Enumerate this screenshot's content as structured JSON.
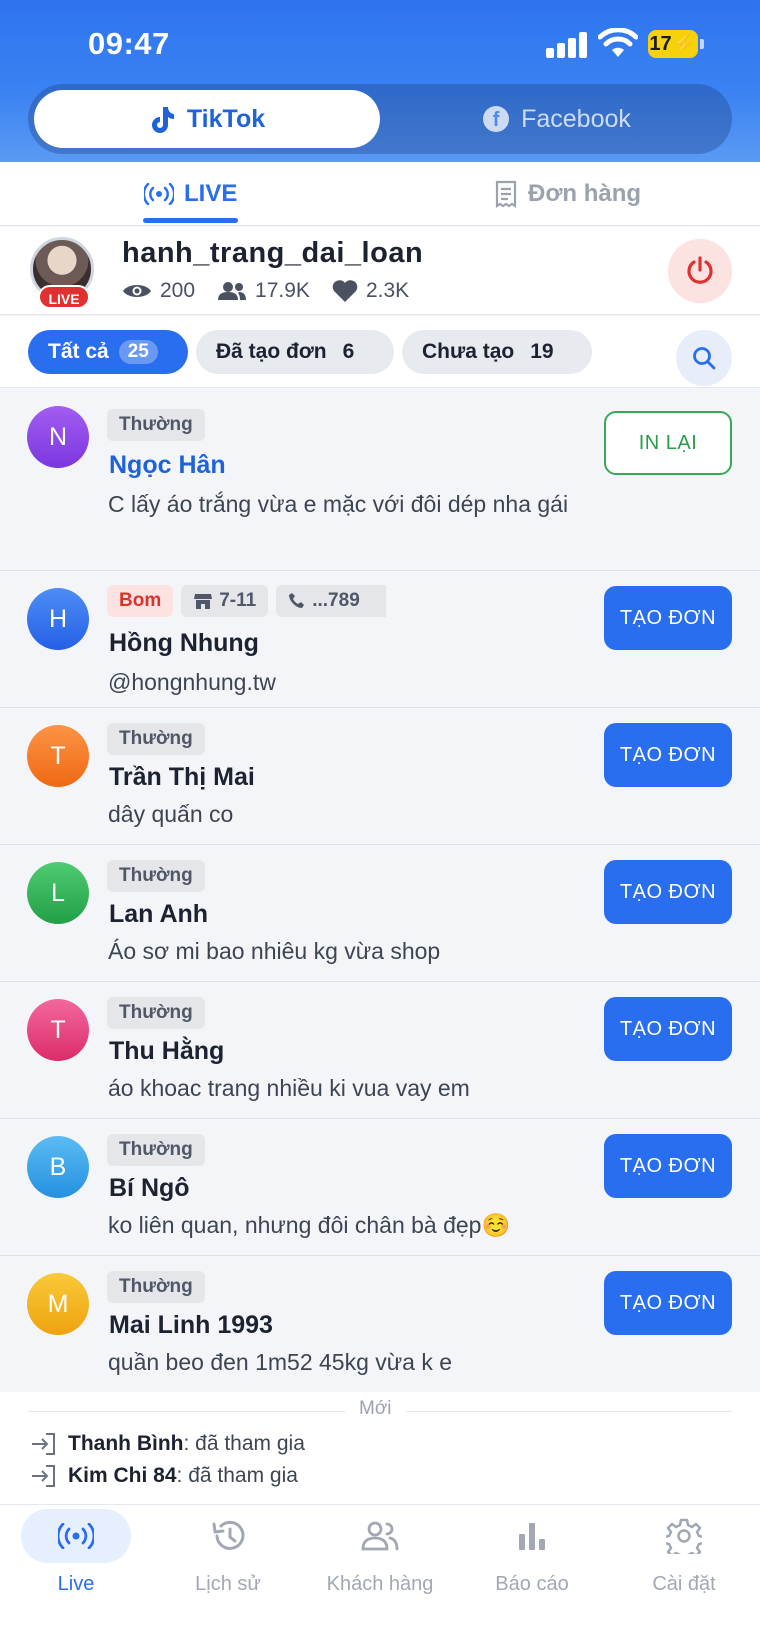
{
  "status": {
    "time": "09:47",
    "battery": "17"
  },
  "platforms": {
    "tiktok": "TikTok",
    "facebook": "Facebook"
  },
  "subtabs": {
    "live": "LIVE",
    "orders": "Đơn hàng"
  },
  "profile": {
    "username": "hanh_trang_dai_loan",
    "live_badge": "LIVE",
    "viewers": "200",
    "followers": "17.9K",
    "likes": "2.3K"
  },
  "filters": [
    {
      "label": "Tất cả",
      "count": "25"
    },
    {
      "label": "Đã tạo đơn",
      "count": "6"
    },
    {
      "label": "Chưa tạo",
      "count": "19"
    }
  ],
  "comments": [
    {
      "initial": "N",
      "color": "#8b45e8",
      "tag": "Thường",
      "name": "Ngọc Hân",
      "message": "C lấy áo trắng vừa e mặc với đôi dép nha gái",
      "action": "IN LẠI"
    },
    {
      "initial": "H",
      "color": "#2d6ff0",
      "tag": "Bom",
      "store": "7-11",
      "phone": "...789",
      "name": "Hồng Nhung",
      "message": "@hongnhung.tw",
      "action": "TẠO ĐƠN"
    },
    {
      "initial": "T",
      "color": "#f77a1c",
      "tag": "Thường",
      "name": "Trần Thị Mai",
      "message": "dây quấn co",
      "action": "TẠO ĐƠN"
    },
    {
      "initial": "L",
      "color": "#2fb455",
      "tag": "Thường",
      "name": "Lan Anh",
      "message": "Áo sơ mi bao nhiêu kg vừa shop",
      "action": "TẠO ĐƠN"
    },
    {
      "initial": "T",
      "color": "#e9447e",
      "tag": "Thường",
      "name": "Thu Hằng",
      "message": "áo khoac trang nhiều ki vua vay em",
      "action": "TẠO ĐƠN"
    },
    {
      "initial": "B",
      "color": "#3aa3ea",
      "tag": "Thường",
      "name": "Bí Ngô",
      "message": "ko liên quan, nhưng đôi chân bà đẹp☺️",
      "action": "TẠO ĐƠN"
    },
    {
      "initial": "M",
      "color": "#f2b21b",
      "tag": "Thường",
      "name": "Mai Linh 1993",
      "message": "quần beo đen 1m52 45kg vừa k e",
      "action": "TẠO ĐƠN"
    }
  ],
  "activity": {
    "label": "Mới",
    "events": [
      {
        "name": "Thanh Bình",
        "text": ": đã tham gia"
      },
      {
        "name": "Kim Chi 84",
        "text": ": đã tham gia"
      }
    ]
  },
  "nav": [
    {
      "label": "Live",
      "icon": "broadcast-icon"
    },
    {
      "label": "Lịch sử",
      "icon": "history-icon"
    },
    {
      "label": "Khách hàng",
      "icon": "customers-icon"
    },
    {
      "label": "Báo cáo",
      "icon": "chart-icon"
    },
    {
      "label": "Cài đặt",
      "icon": "gear-icon"
    }
  ]
}
